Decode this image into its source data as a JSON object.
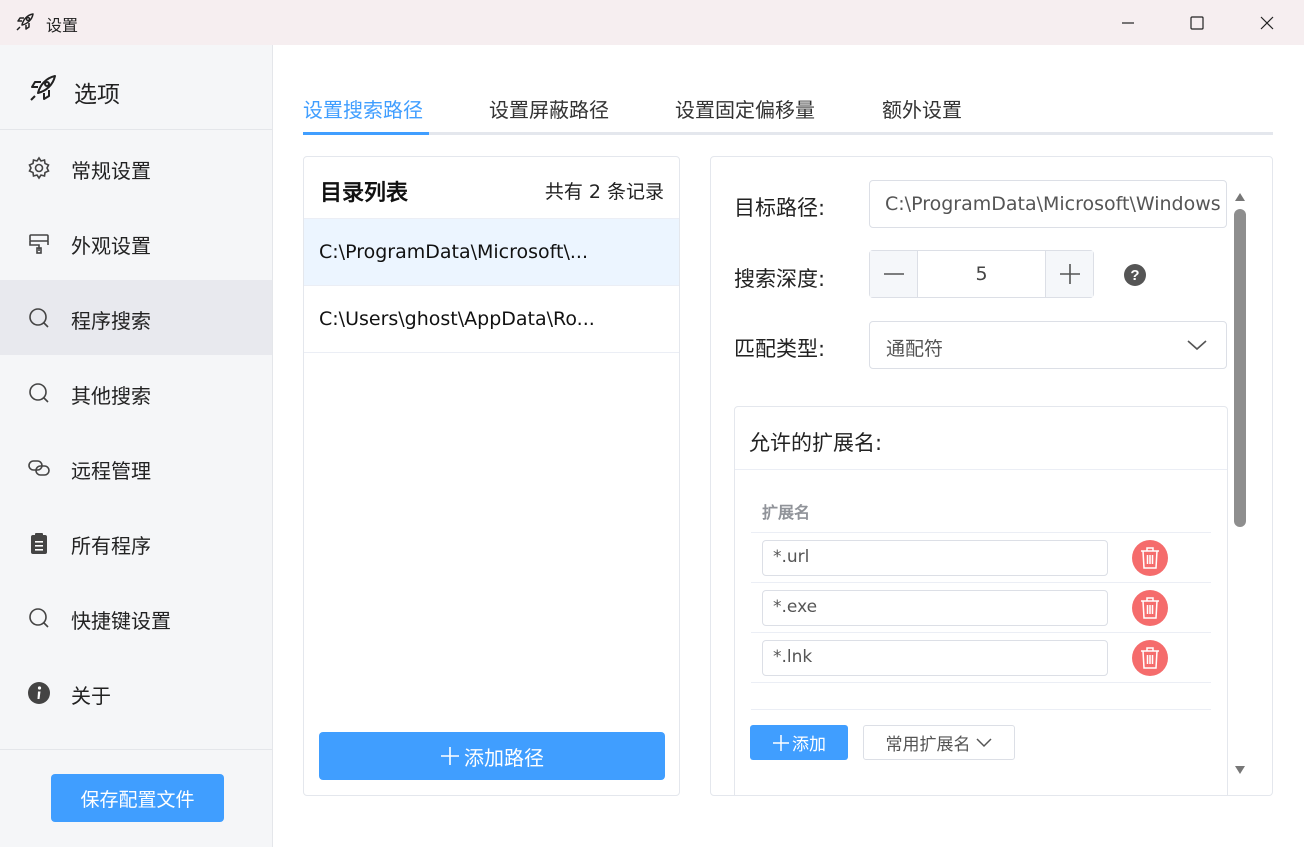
{
  "window": {
    "title": "设置",
    "controls": [
      "minimize",
      "maximize",
      "close"
    ]
  },
  "sidebar": {
    "header": "选项",
    "items": [
      {
        "label": "常规设置",
        "icon": "gear-icon"
      },
      {
        "label": "外观设置",
        "icon": "brush-icon"
      },
      {
        "label": "程序搜索",
        "icon": "search-icon",
        "active": true
      },
      {
        "label": "其他搜索",
        "icon": "search-icon"
      },
      {
        "label": "远程管理",
        "icon": "link-icon"
      },
      {
        "label": "所有程序",
        "icon": "clipboard-icon"
      },
      {
        "label": "快捷键设置",
        "icon": "search-icon"
      },
      {
        "label": "关于",
        "icon": "info-icon"
      }
    ],
    "save_button": "保存配置文件"
  },
  "tabs": [
    {
      "label": "设置搜索路径",
      "active": true
    },
    {
      "label": "设置屏蔽路径"
    },
    {
      "label": "设置固定偏移量"
    },
    {
      "label": "额外设置"
    }
  ],
  "directory_list": {
    "title": "目录列表",
    "count_text": "共有 2 条记录",
    "rows": [
      {
        "text": "C:\\ProgramData\\Microsoft\\...",
        "selected": true
      },
      {
        "text": "C:\\Users\\ghost\\AppData\\Ro..."
      }
    ],
    "add_button": "添加路径"
  },
  "form": {
    "target_path_label": "目标路径:",
    "target_path_value": "C:\\ProgramData\\Microsoft\\Windows",
    "depth_label": "搜索深度:",
    "depth_value": "5",
    "match_type_label": "匹配类型:",
    "match_type_value": "通配符",
    "extensions": {
      "title": "允许的扩展名:",
      "column_header": "扩展名",
      "items": [
        "*.url",
        "*.exe",
        "*.lnk"
      ],
      "add_button": "添加",
      "common_button": "常用扩展名"
    }
  },
  "colors": {
    "accent": "#409eff",
    "danger": "#f56c6c",
    "sidebar_bg": "#f5f6f8",
    "titlebar_bg": "#f6eef0"
  }
}
